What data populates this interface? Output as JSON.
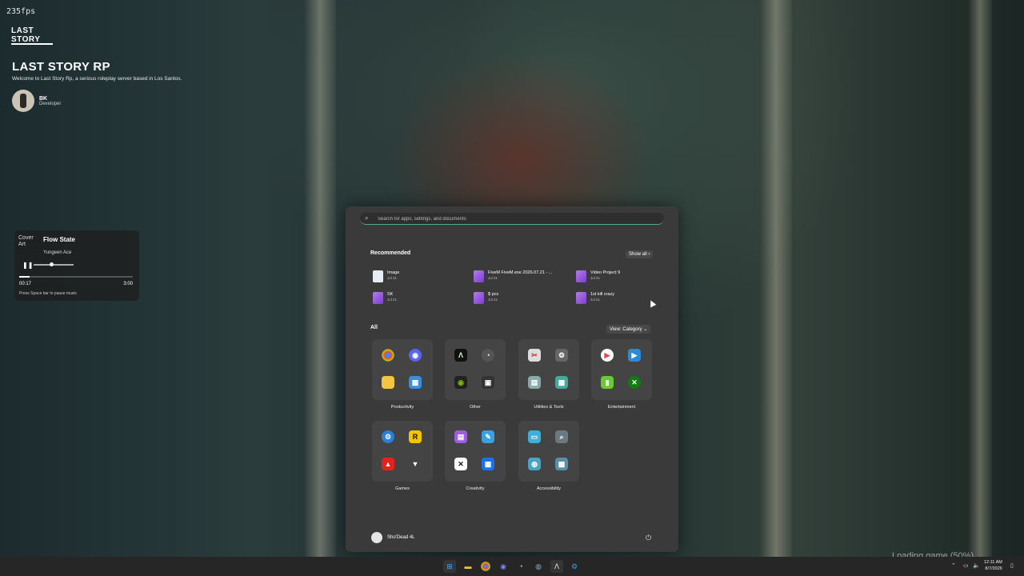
{
  "overlay": {
    "fps": "235fps",
    "logo_text": "LAST STORY",
    "title": "LAST STORY RP",
    "subtitle": "Welcome to Last Story Rp, a serious roleplay server based in Los Santos.",
    "dev_name": "BK",
    "dev_role": "Developer"
  },
  "music": {
    "cover_alt": "Cover Art",
    "track": "Flow State",
    "artist": "Yungeen Ace",
    "elapsed": "00:17",
    "duration": "3:00",
    "progress": 0.095,
    "hint": "Press Space bar to pause music"
  },
  "start_menu": {
    "search_placeholder": "Search for apps, settings, and documents",
    "recommended_label": "Recommended",
    "show_all": "Show all",
    "recommended": [
      {
        "name": "Image",
        "date": "Jul 21",
        "kind": "doc"
      },
      {
        "name": "FiveM FiveM.exe 2026.07.21 - ...",
        "date": "Jul 21",
        "kind": "video"
      },
      {
        "name": "Video Project 9",
        "date": "Jul 21",
        "kind": "video"
      },
      {
        "name": "SK",
        "date": "Jul 21",
        "kind": "video"
      },
      {
        "name": "$ pcs",
        "date": "Jul 21",
        "kind": "video"
      },
      {
        "name": "1st kill crazy",
        "date": "Jul 21",
        "kind": "video"
      }
    ],
    "all_label": "All",
    "view_category": "View: Category",
    "folders": [
      {
        "label": "Productivity"
      },
      {
        "label": "Other"
      },
      {
        "label": "Utilities & Tools"
      },
      {
        "label": "Entertainment"
      },
      {
        "label": "Games"
      },
      {
        "label": "Creativity"
      },
      {
        "label": "Accessibility"
      }
    ],
    "user_name": "Sho'Dead 4L"
  },
  "loading_text": "Loading game (50%)",
  "taskbar": {
    "time": "12:11 AM",
    "date": "8/7/2026"
  },
  "colors": {
    "menu_bg": "#3a3a3a",
    "folder_bg": "#444444",
    "taskbar_bg": "#262626"
  }
}
